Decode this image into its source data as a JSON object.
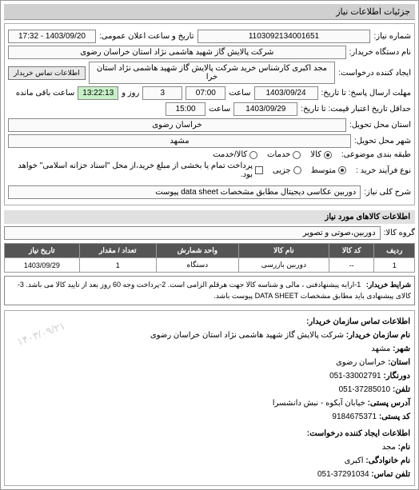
{
  "header": {
    "title": "جزئیات اطلاعات نیاز"
  },
  "main": {
    "request_number_label": "شماره نیاز:",
    "request_number": "1103092134001651",
    "announce_label": "تاریخ و ساعت اعلان عمومی:",
    "announce_value": "1403/09/20 - 17:32",
    "buyer_org_label": "نام دستگاه خریدار:",
    "buyer_org": "شرکت پالایش گاز شهید هاشمی نژاد   استان خراسان رضوی",
    "creator_label": "ایجاد کننده درخواست:",
    "creator": "مجد اکبری کارشناس خرید شرکت پالایش گاز شهید هاشمی نژاد   استان خرا",
    "contact_btn": "اطلاعات تماس خریدار",
    "deadline_label": "مهلت ارسال پاسخ: تا تاریخ:",
    "deadline_date": "1403/09/24",
    "time_lbl1": "ساعت",
    "deadline_time": "07:00",
    "days_remaining": "3",
    "remaining_and": "روز و",
    "remaining_time": "13:22:13",
    "remaining_suffix": "ساعت باقی مانده",
    "validity_label": "حداقل تاریخ اعتبار قیمت: تا تاریخ:",
    "validity_date": "1403/09/29",
    "validity_time": "15:00",
    "province_label": "استان محل تحویل:",
    "province": "خراسان رضوی",
    "city_label": "شهر محل تحویل:",
    "city": "مشهد",
    "subject_type_label": "طبقه بندی موضوعی:",
    "radio_kala": "کالا",
    "radio_khadamat": "خدمات",
    "radio_kala_khadamat": "کالا/خدمت",
    "process_label": "نوع فرآیند خرید :",
    "radio_medium": "متوسط",
    "radio_large_text": "پرداخت تمام یا بخشی از مبلغ خرید،از محل \"اسناد خزانه اسلامی\" خواهد بود.",
    "radio_small": "جزیی",
    "desc_label": "شرح کلی نیاز:",
    "desc": "دوربین عکاسی دیجیتال مطابق مشخصات data sheet پیوست"
  },
  "items_section_title": "اطلاعات کالاهای مورد نیاز",
  "group_label": "گروه کالا:",
  "group_value": "دوربین،صوتی و تصویر",
  "table": {
    "headers": [
      "ردیف",
      "کد کالا",
      "نام کالا",
      "واحد شمارش",
      "تعداد / مقدار",
      "تاریخ نیاز"
    ],
    "row": [
      "1",
      "--",
      "دوربین بازرسی",
      "دستگاه",
      "1",
      "1403/09/29"
    ]
  },
  "purchase": {
    "label": "شرایط خریدار:",
    "text": "1-ارایه پیشنهادفنی ، مالی و شناسه کالا جهت هرقلم الزامی است. 2-پرداخت وجه 60 روز بعد از تایید کالا می باشد. 3-کالای پیشنهادی باید مطابق مشخصات DATA SHEET پیوست باشد."
  },
  "contact": {
    "title": "اطلاعات تماس سازمان خریدار:",
    "org_label": "نام سازمان خریدار:",
    "org": "شرکت پالایش گاز شهید هاشمی نژاد استان خراسان رضوی",
    "city_label": "شهر:",
    "city": "مشهد",
    "province_label": "استان:",
    "province": "خراسان رضوی",
    "fax_label": "دورنگار:",
    "fax": "33002791-051",
    "tel_label": "تلفن:",
    "tel": "37285010-051",
    "address_label": "آدرس پستی:",
    "address": "خیابان آبکوه - نبش دانشسرا",
    "postal_label": "کد پستی:",
    "postal": "9184675371",
    "creator_section": "اطلاعات ایجاد کننده درخواست:",
    "name_label": "نام:",
    "name": "مجد",
    "family_label": "نام خانوادگی:",
    "family": "اکبری",
    "phone_label": "تلفن تماس:",
    "phone": "37291034-051"
  },
  "watermark": "۱۴۰۳/۰۹/۲۱"
}
